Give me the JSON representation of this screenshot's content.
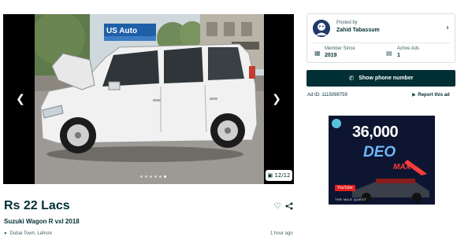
{
  "gallery": {
    "counter": "12/12",
    "sign_text": "US Auto",
    "dots": 6,
    "active_dot": 5
  },
  "listing": {
    "price": "Rs 22 Lacs",
    "title": "Suzuki Wagon R vxl 2018",
    "location": "Dubai Town, Lahore",
    "posted_time": "1 hour ago"
  },
  "seller": {
    "posted_by_label": "Posted by",
    "name": "Zahid Tabassum",
    "member_since_label": "Member Since",
    "member_since": "2019",
    "active_ads_label": "Active Ads",
    "active_ads": "1"
  },
  "actions": {
    "show_phone_label": "Show phone number",
    "ad_id": "Ad ID: 1115098759",
    "report_label": "Report this ad"
  },
  "banner": {
    "headline_number": "36,000",
    "brand": "DEO",
    "brand_suffix": "MAX",
    "youtube_label": "YouTube",
    "footer": "THE MILE QUEST"
  },
  "icons": {
    "prev": "chevron-left-icon",
    "next": "chevron-right-icon",
    "heart": "heart-icon",
    "share": "share-icon",
    "location": "location-pin-icon",
    "phone": "phone-icon",
    "flag": "flag-icon",
    "calendar": "calendar-icon",
    "ads": "document-icon"
  },
  "colors": {
    "primary": "#002f34",
    "muted": "#406367"
  }
}
